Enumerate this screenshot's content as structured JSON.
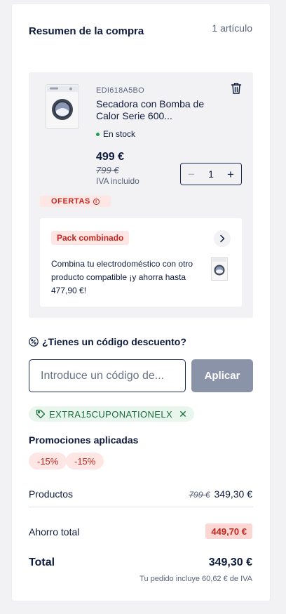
{
  "summary": {
    "title": "Resumen de la compra",
    "item_count": "1 artículo"
  },
  "product": {
    "sku": "EDI618A5BO",
    "name": "Secadora con Bomba de Calor Serie 600...",
    "stock": "En stock",
    "price": "499 €",
    "old_price": "799 €",
    "vat_note": "IVA incluido",
    "quantity": "1",
    "icons": {
      "delete": "trash-icon",
      "decrease": "minus-icon",
      "increase": "plus-icon"
    }
  },
  "offers_badge": "OFERTAS",
  "pack": {
    "tag": "Pack combinado",
    "text": "Combina tu electrodoméstico con otro producto compatible ¡y ahorra hasta 477,90 €!",
    "icon": "chevron-right-icon"
  },
  "discount": {
    "question": "¿Tienes un código descuento?",
    "placeholder": "Introduce un código de...",
    "apply_label": "Aplicar",
    "applied_code": "EXTRA15CUPONATIONELX"
  },
  "promotions": {
    "title": "Promociones aplicadas",
    "items": [
      "-15%",
      "-15%"
    ]
  },
  "totals": {
    "products_label": "Productos",
    "products_old": "799 €",
    "products_value": "349,30 €",
    "savings_label": "Ahorro total",
    "savings_value": "449,70 €",
    "total_label": "Total",
    "total_value": "349,30 €",
    "vat_note": "Tu pedido incluye 60,62 € de IVA"
  },
  "colors": {
    "navy": "#0f1b3d",
    "promo_red": "#c0261e",
    "promo_bg": "#fde6e4",
    "coupon_green": "#1a6b3c",
    "stock_green": "#1f9d55",
    "apply_disabled": "#8a93a7"
  }
}
